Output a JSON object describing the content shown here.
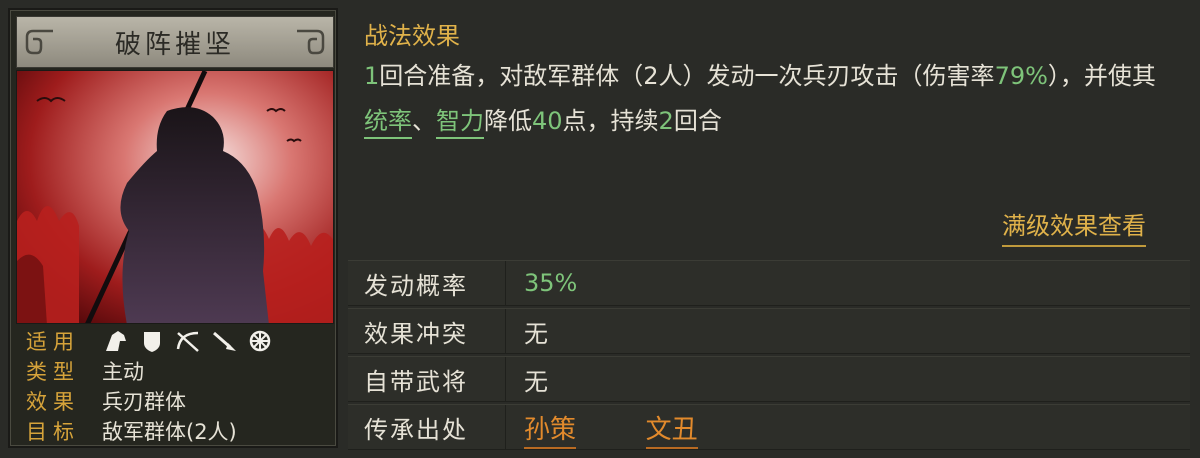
{
  "card": {
    "title": "破阵摧坚",
    "attrs": {
      "applicable_label": "适用",
      "applicable_icons": [
        "cavalry-icon",
        "shield-icon",
        "bow-icon",
        "spear-icon",
        "wheel-icon"
      ],
      "type_label": "类型",
      "type_value": "主动",
      "effect_label": "效果",
      "effect_value": "兵刃群体",
      "target_label": "目标",
      "target_value": "敌军群体(2人)"
    }
  },
  "effect": {
    "title": "战法效果",
    "t1": "1",
    "t2": "回合准备，对敌军群体（2人）发动一次兵刃攻击（伤害率",
    "t3": "79%",
    "t4": "），并使其",
    "t5": "统率",
    "t6": "、",
    "t7": "智力",
    "t8": "降低",
    "t9": "40",
    "t10": "点，持续",
    "t11": "2",
    "t12": "回合",
    "full_link": "满级效果查看"
  },
  "rows": {
    "chance_label": "发动概率",
    "chance_value": "35%",
    "conflict_label": "效果冲突",
    "conflict_value": "无",
    "innate_label": "自带武将",
    "innate_value": "无",
    "inherit_label": "传承出处",
    "inherit_heroes": [
      "孙策",
      "文丑"
    ]
  },
  "colors": {
    "accent_gold": "#e0b24a",
    "green": "#7ec47a",
    "orange": "#e28a2c"
  }
}
